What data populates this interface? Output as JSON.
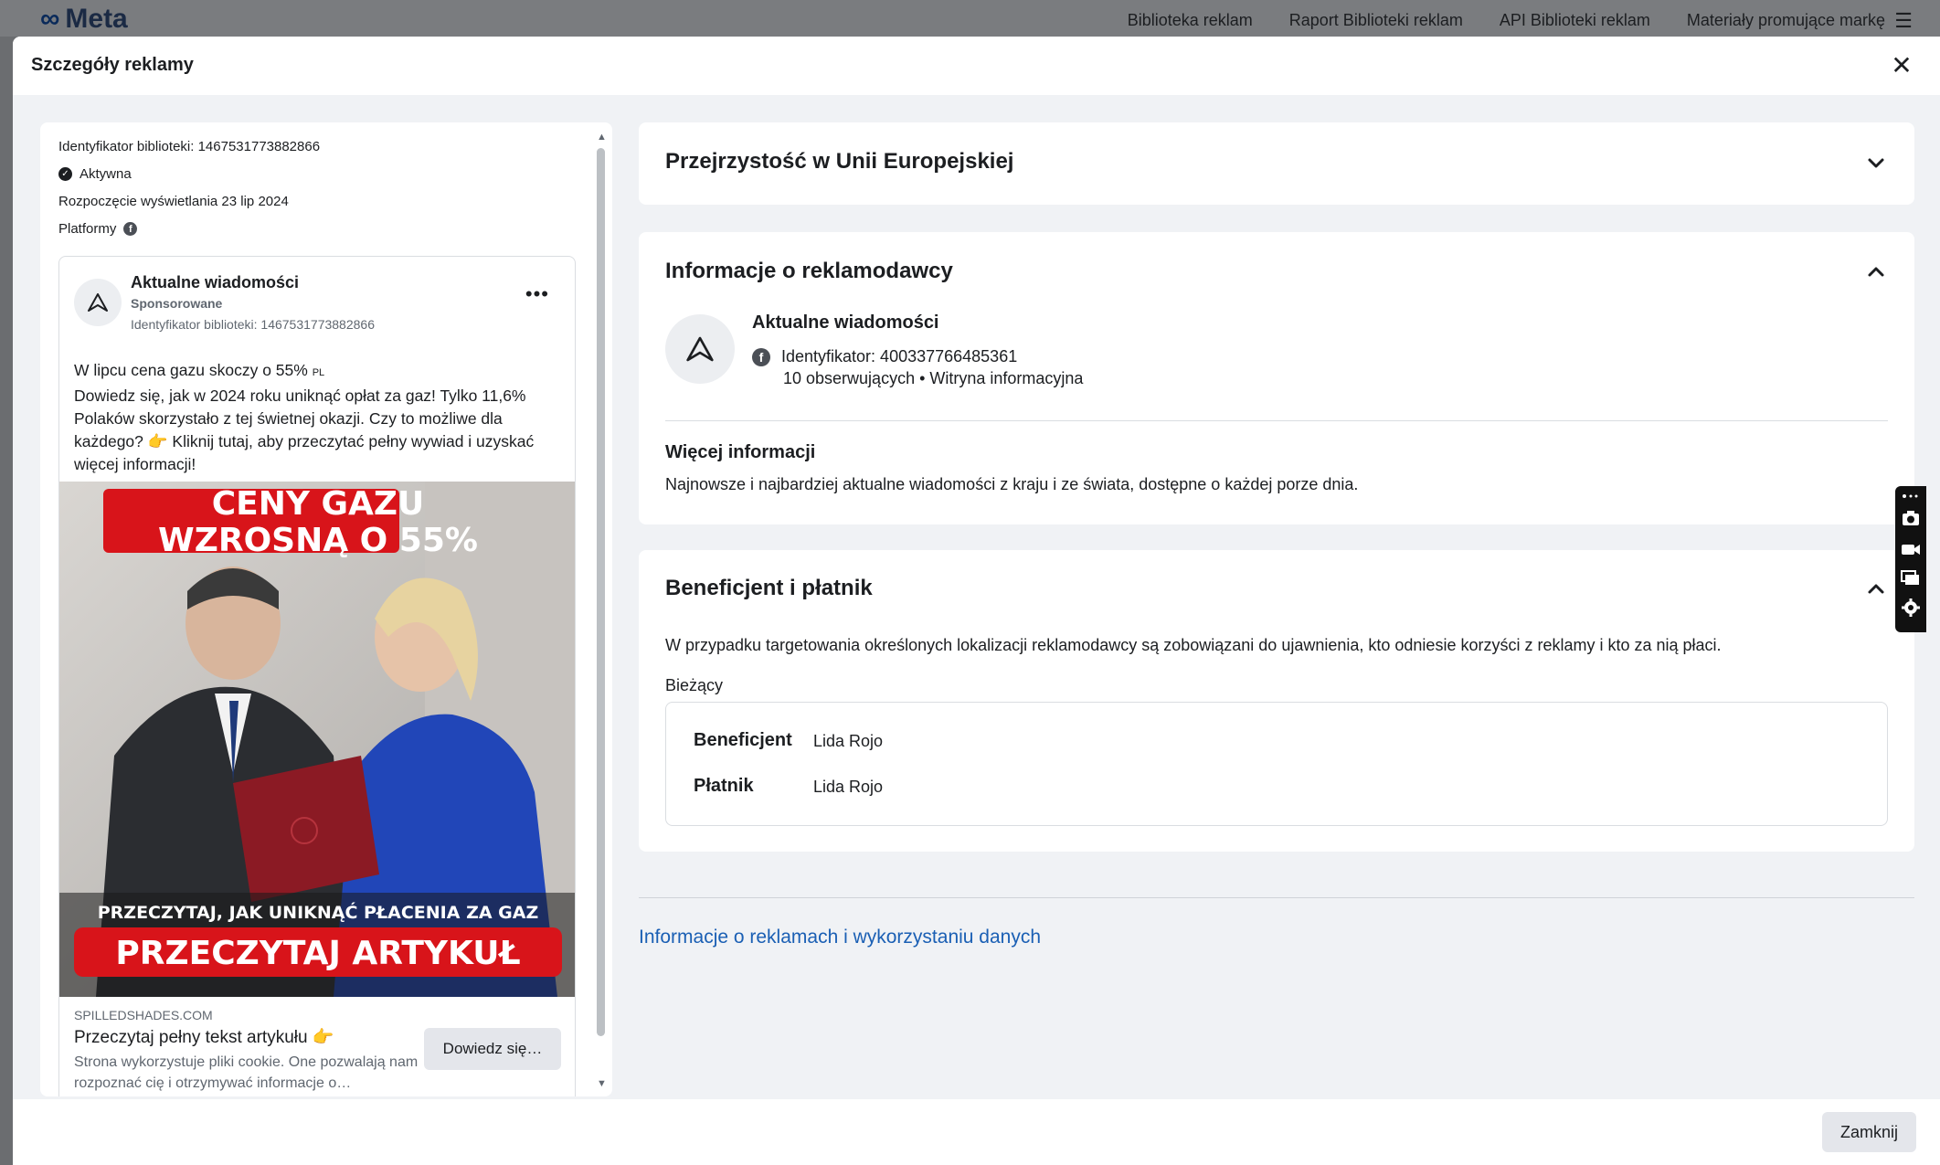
{
  "background": {
    "logo_text": "Meta",
    "nav": [
      "Biblioteka reklam",
      "Raport Biblioteki reklam",
      "API Biblioteki reklam",
      "Materiały promujące markę"
    ]
  },
  "modal": {
    "title": "Szczegóły reklamy",
    "close_button": "Zamknij"
  },
  "ad_meta": {
    "library_id": "Identyfikator biblioteki: 1467531773882866",
    "status": "Aktywna",
    "start": "Rozpoczęcie wyświetlania 23 lip 2024",
    "platforms_label": "Platformy"
  },
  "ad": {
    "page_name": "Aktualne wiadomości",
    "sponsored": "Sponsorowane",
    "library_id": "Identyfikator biblioteki: 1467531773882866",
    "body_line1": "W lipcu cena gazu skoczy o 55%",
    "body_flag": "PL",
    "body_rest": "Dowiedz się, jak w 2024 roku uniknąć opłat za gaz! Tylko 11,6% Polaków skorzystało z tej świetnej okazji. Czy to możliwe dla każdego? 👉 Kliknij tutaj, aby przeczytać pełny wywiad i uzyskać więcej informacji!",
    "image_headline_1": "CENY GAZU",
    "image_headline_2": "WZROSNĄ O 55%",
    "image_sub": "PRZECZYTAJ, JAK UNIKNĄĆ PŁACENIA ZA GAZ",
    "image_cta": "PRZECZYTAJ ARTYKUŁ",
    "link_domain": "SPILLEDSHADES.COM",
    "link_title": "Przeczytaj pełny tekst artykułu 👉",
    "link_desc": "Strona wykorzystuje pliki cookie. One pozwalają nam rozpoznać cię i otrzymywać informacje o…",
    "cta": "Dowiedz się…"
  },
  "sections": {
    "eu": {
      "title": "Przejrzystość w Unii Europejskiej"
    },
    "advertiser": {
      "title": "Informacje o reklamodawcy",
      "name": "Aktualne wiadomości",
      "id_line": "Identyfikator: 400337766485361",
      "followers_line": "10 obserwujących • Witryna informacyjna",
      "more_title": "Więcej informacji",
      "more_text": "Najnowsze i najbardziej aktualne wiadomości z kraju i ze świata, dostępne o każdej porze dnia."
    },
    "beneficiary": {
      "title": "Beneficjent i płatnik",
      "description": "W przypadku targetowania określonych lokalizacji reklamodawcy są zobowiązani do ujawnienia, kto odniesie korzyści z reklamy i kto za nią płaci.",
      "current_label": "Bieżący",
      "rows": [
        {
          "key": "Beneficjent",
          "value": "Lida Rojo"
        },
        {
          "key": "Płatnik",
          "value": "Lida Rojo"
        }
      ]
    }
  },
  "data_link": "Informacje o reklamach i wykorzystaniu danych",
  "colors": {
    "link": "#1a5fb4",
    "image_banner_red": "#d8141a"
  }
}
